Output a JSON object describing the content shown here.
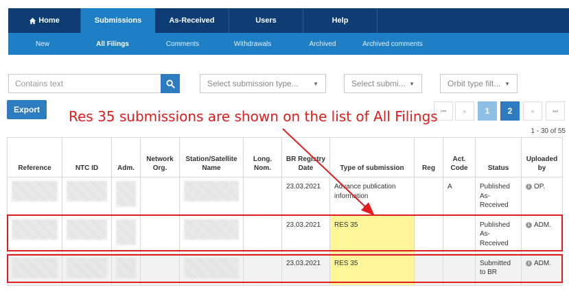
{
  "top_nav": [
    {
      "label": "Home",
      "icon": "home-icon"
    },
    {
      "label": "Submissions",
      "active": true
    },
    {
      "label": "As-Received"
    },
    {
      "label": "Users"
    },
    {
      "label": "Help"
    }
  ],
  "sub_nav": [
    {
      "label": "New"
    },
    {
      "label": "All Filings",
      "active": true
    },
    {
      "label": "Comments"
    },
    {
      "label": "Withdrawals"
    },
    {
      "label": "Archived"
    },
    {
      "label": "Archived comments"
    }
  ],
  "filters": {
    "search_placeholder": "Contains text",
    "submission_type": "Select submission type...",
    "submission_status": "Select submi...",
    "orbit_type": "Orbit type filt..."
  },
  "export_label": "Export",
  "pagination": {
    "first": "⏮",
    "prev": "«",
    "page1": "1",
    "page2": "2",
    "next": "»",
    "last": "⏭",
    "range": "1 - 30 of 55"
  },
  "annotation": "Res 35 submissions are shown on the list of All Filings",
  "table": {
    "headers": {
      "reference": "Reference",
      "ntc_id": "NTC ID",
      "adm": "Adm.",
      "network_org": "Network Org.",
      "station": "Station/Satellite Name",
      "long_nom": "Long. Nom.",
      "br_date": "BR Registry Date",
      "type": "Type of submission",
      "reg": "Reg",
      "act_code": "Act. Code",
      "status": "Status",
      "uploaded_by": "Uploaded by"
    },
    "rows": [
      {
        "br_date": "23.03.2021",
        "type": "Advance publication information",
        "act_code": "A",
        "status": "Published As-Received",
        "uploaded_by": "OP."
      },
      {
        "br_date": "23.03.2021",
        "type": "RES 35",
        "act_code": "",
        "status": "Published As-Received",
        "uploaded_by": "ADM."
      },
      {
        "br_date": "23.03.2021",
        "type": "RES 35",
        "act_code": "",
        "status": "Submitted to BR",
        "uploaded_by": "ADM."
      }
    ]
  },
  "colors": {
    "nav_dark": "#0d3d73",
    "nav_accent": "#1f7fc4",
    "button_blue": "#2e7bbf",
    "highlight": "#fff69a",
    "annotation_red": "#e21c1c"
  }
}
